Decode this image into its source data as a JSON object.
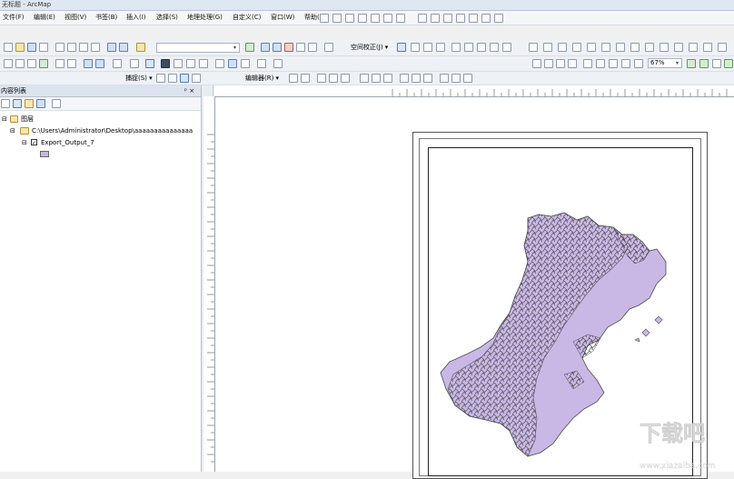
{
  "window": {
    "title": "无标题 - ArcMap"
  },
  "menu": [
    "文件(F)",
    "编辑(E)",
    "视图(V)",
    "书签(B)",
    "插入(I)",
    "选择(S)",
    "地理处理(G)",
    "自定义(C)",
    "窗口(W)",
    "帮助(H)"
  ],
  "toolbar2": {
    "georef_label": "空间校正(J) ▾",
    "scale_value": ""
  },
  "toolbar3": {
    "zoom_value": "67%"
  },
  "toolbar4": {
    "snap_label": "捕捉(S) ▾",
    "editor_label": "编辑器(R) ▾"
  },
  "toc": {
    "title": "内容列表",
    "pin": "ᵖ ×",
    "root_label": "图层",
    "folder_label": "C:\\Users\\Administrator\\Desktop\\aaaaaaaaaaaaaaa",
    "layer_label": "Export_Output_7",
    "layer_checked": true,
    "symbol_color": "#c6b7dd"
  },
  "map": {
    "polygon_fill": "#c9b8e6",
    "polygon_stroke": "#4a4a4a"
  },
  "watermark": {
    "text": "下载吧",
    "subtext": "www.xiazaiba.com"
  }
}
